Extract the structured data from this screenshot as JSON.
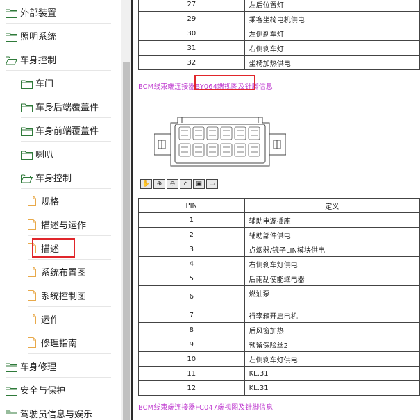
{
  "sidebar": {
    "items": [
      {
        "label": "外部装置",
        "icon": "folder-icon",
        "level": 0
      },
      {
        "label": "照明系统",
        "icon": "folder-icon",
        "level": 0
      },
      {
        "label": "车身控制",
        "icon": "folder-open-icon",
        "level": 0
      },
      {
        "label": "车门",
        "icon": "folder-icon",
        "level": 1
      },
      {
        "label": "车身后端覆盖件",
        "icon": "folder-icon",
        "level": 1
      },
      {
        "label": "车身前端覆盖件",
        "icon": "folder-icon",
        "level": 1
      },
      {
        "label": "喇叭",
        "icon": "folder-icon",
        "level": 1
      },
      {
        "label": "车身控制",
        "icon": "folder-open-icon",
        "level": 1
      },
      {
        "label": "规格",
        "icon": "document-icon",
        "level": 2
      },
      {
        "label": "描述与运作",
        "icon": "document-icon",
        "level": 2
      },
      {
        "label": "描述",
        "icon": "document-icon",
        "level": 2,
        "selected": true
      },
      {
        "label": "系统布置图",
        "icon": "document-icon",
        "level": 2
      },
      {
        "label": "系统控制图",
        "icon": "document-icon",
        "level": 2
      },
      {
        "label": "运作",
        "icon": "document-icon",
        "level": 2
      },
      {
        "label": "修理指南",
        "icon": "document-icon",
        "level": 2
      },
      {
        "label": "车身修理",
        "icon": "folder-icon",
        "level": 0
      },
      {
        "label": "安全与保护",
        "icon": "folder-icon",
        "level": 0
      },
      {
        "label": "驾驶员信息与娱乐",
        "icon": "folder-icon",
        "level": 0
      }
    ]
  },
  "colors": {
    "folder": "#e6b84c",
    "document": "#e8a94a",
    "highlight": "#e0262b",
    "link": "#c03fd0"
  },
  "content": {
    "top_table": {
      "rows": [
        {
          "pin": "27",
          "definition": "左后位置灯"
        },
        {
          "pin": "29",
          "definition": "乘客坐椅电机供电"
        },
        {
          "pin": "30",
          "definition": "左侧刹车灯"
        },
        {
          "pin": "31",
          "definition": "右侧刹车灯"
        },
        {
          "pin": "32",
          "definition": "坐椅加热供电"
        }
      ]
    },
    "connector_title_1": "BCM线束端连接器BY064端视图及针脚信息",
    "viewer_tools": [
      "pan-icon",
      "zoom-in-icon",
      "zoom-out-icon",
      "home-icon",
      "fit-icon",
      "window-icon"
    ],
    "pin_table": {
      "header_pin": "PIN",
      "header_def": "定义",
      "rows": [
        {
          "pin": "1",
          "definition": "辅助电源插座"
        },
        {
          "pin": "2",
          "definition": "辅助部件供电"
        },
        {
          "pin": "3",
          "definition": "点烟器/镜子LIN模块供电"
        },
        {
          "pin": "4",
          "definition": "右侧刹车灯供电"
        },
        {
          "pin": "5",
          "definition": "后雨刮使能继电器"
        },
        {
          "pin": "6",
          "definition": "燃油泵"
        },
        {
          "pin": "7",
          "definition": "行李箱开启电机"
        },
        {
          "pin": "8",
          "definition": "后风窗加热"
        },
        {
          "pin": "9",
          "definition": "预留保险丝2"
        },
        {
          "pin": "10",
          "definition": "左侧刹车灯供电"
        },
        {
          "pin": "11",
          "definition": "KL.31"
        },
        {
          "pin": "12",
          "definition": "KL.31"
        }
      ]
    },
    "connector_title_2": "BCM线束端连接器FC047端视图及针脚信息"
  }
}
